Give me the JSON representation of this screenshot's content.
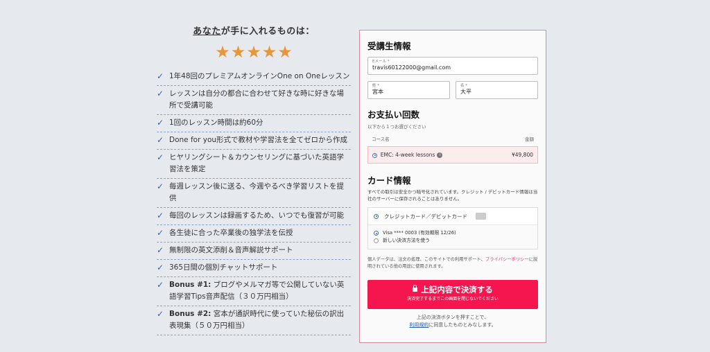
{
  "left": {
    "heading_em": "あなた",
    "heading_rest": "が手に入れるものは：",
    "star_count": 5,
    "benefits": [
      {
        "bold": "",
        "text": "1年48回のプレミアムオンラインOne on Oneレッスン"
      },
      {
        "bold": "",
        "text": "レッスンは自分の都合に合わせて好きな時に好きな場所で受講可能"
      },
      {
        "bold": "",
        "text": "1回のレッスン時間は約60分"
      },
      {
        "bold": "",
        "text": "Done for you形式で教材や学習法を全てゼロから作成"
      },
      {
        "bold": "",
        "text": "ヒヤリングシート＆カウンセリングに基づいた英語学習法を策定"
      },
      {
        "bold": "",
        "text": "毎週レッスン後に送る、今週やるべき学習リストを提供"
      },
      {
        "bold": "",
        "text": "毎回のレッスンは録画するため、いつでも復習が可能"
      },
      {
        "bold": "",
        "text": "各生徒に合った卒業後の独学法を伝授"
      },
      {
        "bold": "",
        "text": "無制限の英文添削＆音声解説サポート"
      },
      {
        "bold": "",
        "text": "365日間の個別チャットサポート"
      },
      {
        "bold": "Bonus #1:",
        "text": " ブログやメルマガ等で公開していない英語学習Tips音声配信（３０万円相当）"
      },
      {
        "bold": "Bonus #2:",
        "text": " 宮本が通訳時代に使っていた秘伝の訳出表現集（５０万円相当）"
      }
    ]
  },
  "form": {
    "student_title": "受講生情報",
    "email_label": "Eメール *",
    "email_value": "travis60122000@gmail.com",
    "last_label": "姓 *",
    "last_value": "宮本",
    "first_label": "名 *",
    "first_value": "大平",
    "payment_title": "お支払い回数",
    "payment_sub": "以下から１つお選びください",
    "course_col": "コース名",
    "price_col": "金額",
    "course_name": "EMC: 4-week lessons",
    "course_price": "¥49,800",
    "card_title": "カード情報",
    "card_desc": "すべての取引は安全かつ暗号化されています。クレジット / デビットカード情報は当社のサーバーに保存されることはありません。",
    "credit_option": "クレジットカード／デビットカード",
    "saved_card": "Visa **** 0003 (有効期限 12/26)",
    "new_method": "新しい決済方法を使う",
    "privacy_pre": "個人データは、注文の処理、このサイトでの利用サポート、",
    "privacy_link": "プライバシーポリシー",
    "privacy_post": "に説明されている他の用途に使用されます。",
    "submit_main": "上記内容で決済する",
    "submit_sub": "決済完了するまでこの画面を閉じないでください",
    "after_line1": "上記の決済ボタンを押すことで、",
    "terms_link": "利用規約",
    "after_line2": "に同意したものとみなします。"
  },
  "colors": {
    "accent": "#f6164f",
    "star": "#e8963a",
    "check": "#3a5ea8",
    "link": "#e23a6a"
  }
}
